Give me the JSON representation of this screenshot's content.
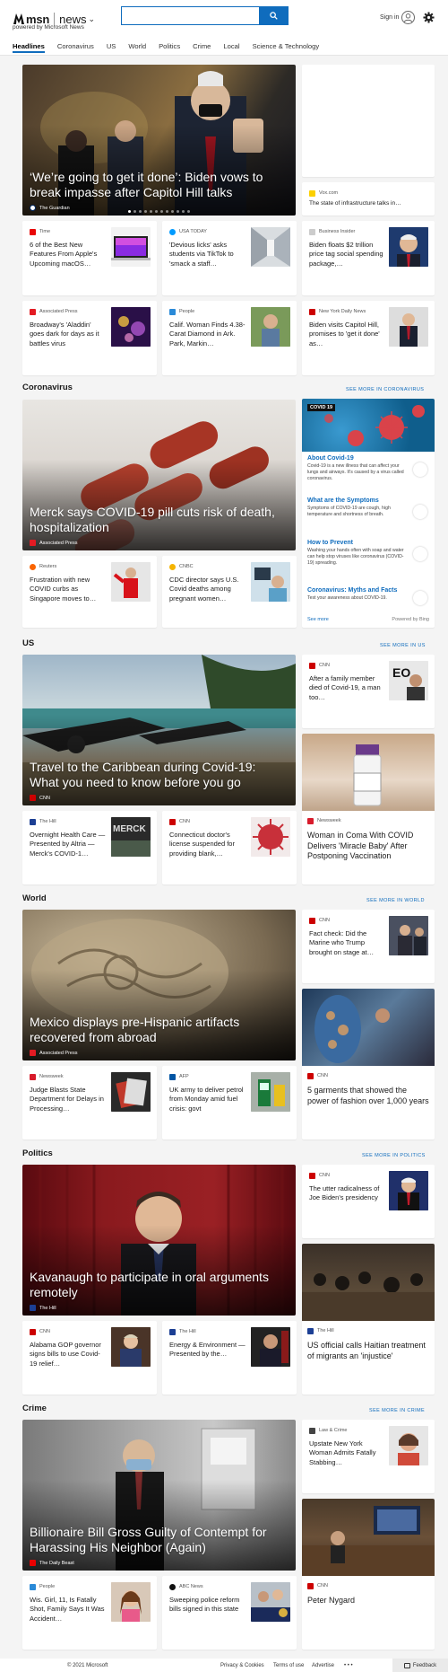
{
  "header": {
    "brand": "msn",
    "product": "news",
    "powered_by": "powered by Microsoft News",
    "search_placeholder": "",
    "signin": "Sign in"
  },
  "nav": [
    "Headlines",
    "Coronavirus",
    "US",
    "World",
    "Politics",
    "Crime",
    "Local",
    "Science & Technology"
  ],
  "headlines": {
    "hero": {
      "title": "‘We’re going to get it done’: Biden vows to break impasse after Capitol Hill talks",
      "source": "The Guardian",
      "dots": 12,
      "active_dot": 0
    },
    "side": {
      "source": "Vox.com",
      "title": "The state of infrastructure talks in…"
    },
    "cards": [
      {
        "source": "Time",
        "title": "6 of the Best New Features From Apple's Upcoming macOS…"
      },
      {
        "source": "USA TODAY",
        "title": "'Devious licks' asks students via TikTok to 'smack a staff…"
      },
      {
        "source": "Business Insider",
        "title": "Biden floats $2 trillion price tag social spending package,…"
      },
      {
        "source": "Associated Press",
        "title": "Broadway's 'Aladdin' goes dark for days as it battles virus"
      },
      {
        "source": "People",
        "title": "Calif. Woman Finds 4.38-Carat Diamond in Ark. Park, Markin…"
      },
      {
        "source": "New York Daily News",
        "title": "Biden visits Capitol Hill, promises to 'get it done' as…"
      }
    ]
  },
  "coronavirus": {
    "heading": "Coronavirus",
    "more": "SEE MORE IN CORONAVIRUS",
    "hero": {
      "title": "Merck says COVID-19 pill cuts risk of death, hospitalization",
      "source": "Associated Press"
    },
    "cards": [
      {
        "source": "Reuters",
        "title": "Frustration with new COVID curbs as Singapore moves to…"
      },
      {
        "source": "CNBC",
        "title": "CDC director says U.S. Covid deaths among pregnant women…"
      }
    ],
    "panel": {
      "tag": "COVID 19",
      "items": [
        {
          "title": "About Covid-19",
          "desc": "Covid-19 is a new illness that can affect your lungs and airways. It's caused by a virus called coronavirus."
        },
        {
          "title": "What are the Symptoms",
          "desc": "Symptoms of COVID-19 are cough, high temperature and shortness of breath."
        },
        {
          "title": "How to Prevent",
          "desc": "Washing your hands often with soap and water can help stop viruses like coronavirus (COVID-19) spreading."
        },
        {
          "title": "Coronavirus: Myths and Facts",
          "desc": "Test your awareness about COVID-19."
        }
      ],
      "see_more": "See more",
      "powered": "Powered by Bing"
    }
  },
  "us": {
    "heading": "US",
    "more": "SEE MORE IN US",
    "hero": {
      "title": "Travel to the Caribbean during Covid-19: What you need to know before you go",
      "source": "CNN"
    },
    "side": {
      "source": "CNN",
      "title": "After a family member died of Covid-19, a man too…"
    },
    "big": {
      "source": "Newsweek",
      "title": "Woman in Coma With COVID Delivers 'Miracle Baby' After Postponing Vaccination"
    },
    "cards": [
      {
        "source": "The Hill",
        "title": "Overnight Health Care — Presented by Altria — Merck's COVID-1…"
      },
      {
        "source": "CNN",
        "title": "Connecticut doctor's license suspended for providing blank,…"
      }
    ]
  },
  "world": {
    "heading": "World",
    "more": "SEE MORE IN WORLD",
    "hero": {
      "title": "Mexico displays pre-Hispanic artifacts recovered from abroad",
      "source": "Associated Press"
    },
    "side": {
      "source": "CNN",
      "title": "Fact check: Did the Marine who Trump brought on stage at…"
    },
    "big": {
      "source": "CNN",
      "title": "5 garments that showed the power of fashion over 1,000 years"
    },
    "cards": [
      {
        "source": "Newsweek",
        "title": "Judge Blasts State Department for Delays in Processing…"
      },
      {
        "source": "AFP",
        "title": "UK army to deliver petrol from Monday amid fuel crisis: govt"
      }
    ]
  },
  "politics": {
    "heading": "Politics",
    "more": "SEE MORE IN POLITICS",
    "hero": {
      "title": "Kavanaugh to participate in oral arguments remotely",
      "source": "The Hill"
    },
    "side": {
      "source": "CNN",
      "title": "The utter radicalness of Joe Biden's presidency"
    },
    "big": {
      "source": "The Hill",
      "title": "US official calls Haitian treatment of migrants an 'injustice'"
    },
    "cards": [
      {
        "source": "CNN",
        "title": "Alabama GOP governor signs bills to use Covid-19 relief…"
      },
      {
        "source": "The Hill",
        "title": "Energy & Environment — Presented by the…"
      }
    ]
  },
  "crime": {
    "heading": "Crime",
    "more": "SEE MORE IN CRIME",
    "hero": {
      "title": "Billionaire Bill Gross Guilty of Contempt for Harassing His Neighbor (Again)",
      "source": "The Daily Beast"
    },
    "side": {
      "source": "Law & Crime",
      "title": "Upstate New York Woman Admits Fatally Stabbing…"
    },
    "big": {
      "source": "CNN",
      "title": "Peter Nygard"
    },
    "cards": [
      {
        "source": "People",
        "title": "Wis. Girl, 11, Is Fatally Shot, Family Says It Was Accident…"
      },
      {
        "source": "ABC News",
        "title": "Sweeping police reform bills signed in this state"
      }
    ]
  },
  "footer": {
    "copyright": "© 2021 Microsoft",
    "links": [
      "Privacy & Cookies",
      "Terms of use",
      "Advertise"
    ],
    "more": "• • •",
    "feedback": "Feedback"
  }
}
